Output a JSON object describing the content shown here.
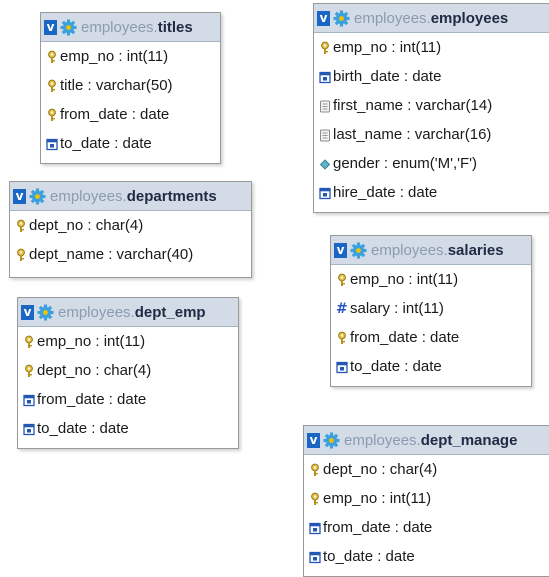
{
  "tables": [
    {
      "id": "titles",
      "db": "employees",
      "name": "titles",
      "columns": [
        {
          "icon": "primary-key-icon",
          "text": "emp_no : int(11)"
        },
        {
          "icon": "primary-key-icon",
          "text": "title : varchar(50)"
        },
        {
          "icon": "primary-key-icon",
          "text": "from_date : date"
        },
        {
          "icon": "date-icon",
          "text": "to_date : date"
        }
      ]
    },
    {
      "id": "employees",
      "db": "employees",
      "name": "employees",
      "columns": [
        {
          "icon": "primary-key-icon",
          "text": "emp_no : int(11)"
        },
        {
          "icon": "date-icon",
          "text": "birth_date : date"
        },
        {
          "icon": "text-icon",
          "text": "first_name : varchar(14)"
        },
        {
          "icon": "text-icon",
          "text": "last_name : varchar(16)"
        },
        {
          "icon": "enum-icon",
          "text": "gender : enum('M','F')"
        },
        {
          "icon": "date-icon",
          "text": "hire_date : date"
        }
      ]
    },
    {
      "id": "departments",
      "db": "employees",
      "name": "departments",
      "columns": [
        {
          "icon": "primary-key-icon",
          "text": "dept_no : char(4)"
        },
        {
          "icon": "primary-key-icon",
          "text": "dept_name : varchar(40)"
        }
      ]
    },
    {
      "id": "salaries",
      "db": "employees",
      "name": "salaries",
      "columns": [
        {
          "icon": "primary-key-icon",
          "text": "emp_no : int(11)"
        },
        {
          "icon": "number-icon",
          "text": "salary : int(11)"
        },
        {
          "icon": "primary-key-icon",
          "text": "from_date : date"
        },
        {
          "icon": "date-icon",
          "text": "to_date : date"
        }
      ]
    },
    {
      "id": "dept_emp",
      "db": "employees",
      "name": "dept_emp",
      "columns": [
        {
          "icon": "primary-key-icon",
          "text": "emp_no : int(11)"
        },
        {
          "icon": "primary-key-icon",
          "text": "dept_no : char(4)"
        },
        {
          "icon": "date-icon",
          "text": "from_date : date"
        },
        {
          "icon": "date-icon",
          "text": "to_date : date"
        }
      ]
    },
    {
      "id": "dept_manager",
      "db": "employees",
      "name": "dept_manage",
      "columns": [
        {
          "icon": "primary-key-icon",
          "text": "dept_no : char(4)"
        },
        {
          "icon": "primary-key-icon",
          "text": "emp_no : int(11)"
        },
        {
          "icon": "date-icon",
          "text": "from_date : date"
        },
        {
          "icon": "date-icon",
          "text": "to_date : date"
        }
      ]
    }
  ],
  "toggle_glyph": "v",
  "separator": ".",
  "number_glyph": "#"
}
